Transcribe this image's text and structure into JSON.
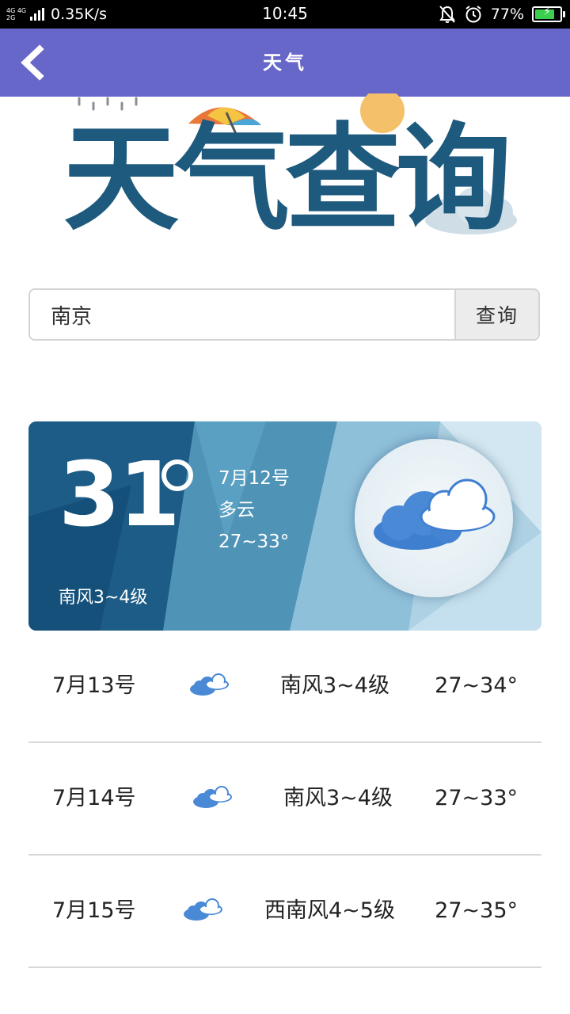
{
  "status_bar": {
    "network_top": "4G 4G",
    "network_bottom": "2G",
    "speed": "0.35K/s",
    "time": "10:45",
    "battery": "77%",
    "icons": [
      "signal-icon",
      "mute-icon",
      "alarm-icon",
      "battery-icon"
    ]
  },
  "header": {
    "title": "天气",
    "back_icon": "chevron-left-icon",
    "color": "#6766c9"
  },
  "banner": {
    "title": "天气查询"
  },
  "search": {
    "value": "南京",
    "button_label": "查询"
  },
  "current": {
    "temp": "31",
    "date": "7月12号",
    "condition": "多云",
    "range": "27~33°",
    "wind": "南风3~4级",
    "icon": "cloudy-icon"
  },
  "forecast": [
    {
      "date": "7月13号",
      "icon": "cloudy-icon",
      "wind": "南风3~4级",
      "temp": "27~34°"
    },
    {
      "date": "7月14号",
      "icon": "cloudy-icon",
      "wind": "南风3~4级",
      "temp": "27~33°"
    },
    {
      "date": "7月15号",
      "icon": "cloudy-icon",
      "wind": "西南风4~5级",
      "temp": "27~35°"
    }
  ]
}
